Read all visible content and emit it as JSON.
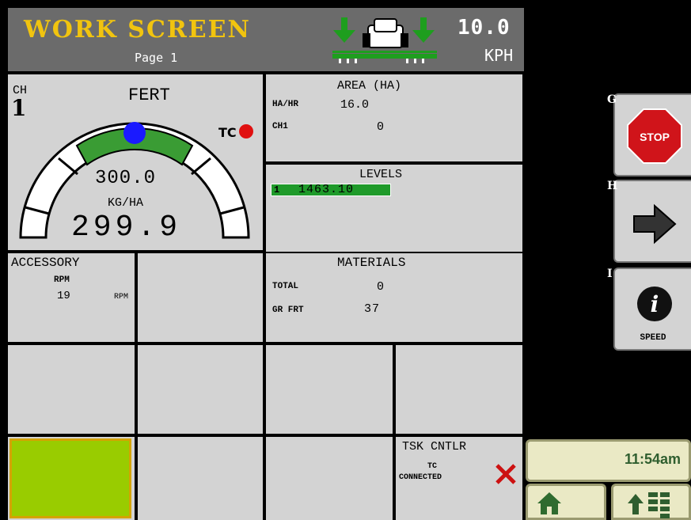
{
  "header": {
    "title": "WORK SCREEN",
    "page": "Page 1",
    "speed": "10.0",
    "speed_unit": "KPH"
  },
  "gauge": {
    "channel_label": "CH",
    "channel_number": "1",
    "product": "FERT",
    "tc_label": "TC",
    "target_rate": "300.0",
    "rate_unit": "KG/HA",
    "actual_rate": "299.9"
  },
  "area": {
    "title": "AREA  (HA)",
    "rows": [
      {
        "label": "HA/HR",
        "value": "16.0"
      },
      {
        "label": "CH1",
        "value": "0"
      }
    ]
  },
  "levels": {
    "title": "LEVELS",
    "entry_index": "1",
    "entry_value": "1463.10"
  },
  "accessory": {
    "title": "ACCESSORY",
    "label": "RPM",
    "value": "19",
    "unit": "RPM"
  },
  "materials": {
    "title": "MATERIALS",
    "rows": [
      {
        "label": "TOTAL",
        "value": "0"
      },
      {
        "label": "GR FRT",
        "value": "37"
      }
    ]
  },
  "task_controller": {
    "title": "TSK CNTLR",
    "line1": "TC",
    "line2": "CONNECTED"
  },
  "softkeys": {
    "g": {
      "letter": "G",
      "icon": "stop-sign-icon",
      "text": "STOP"
    },
    "h": {
      "letter": "H",
      "icon": "right-arrow-icon"
    },
    "i": {
      "letter": "I",
      "icon": "info-icon",
      "glyph": "i",
      "label": "SPEED"
    }
  },
  "status": {
    "clock": "11:54am"
  },
  "colors": {
    "title": "#f1c40f",
    "gauge_green": "#3a9c34",
    "needle": "#1a1aff",
    "tc_dot": "#e01010",
    "stop_red": "#d0141a",
    "x_red": "#cc1111",
    "levels_highlight": "#1f9a2a",
    "selected_cell": "#99cc00"
  }
}
